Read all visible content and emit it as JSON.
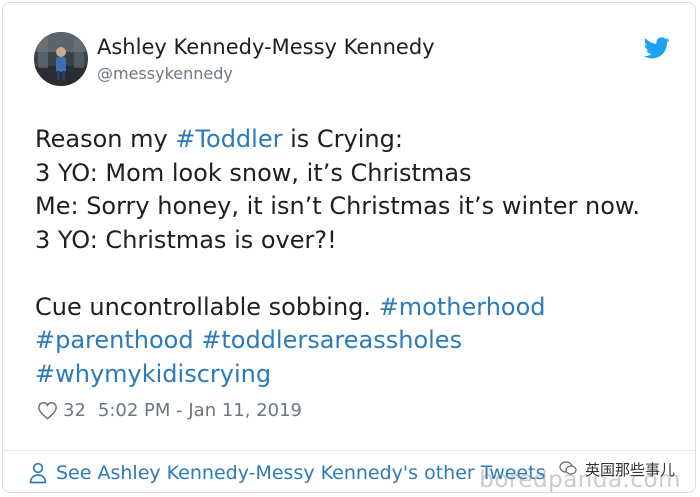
{
  "author": {
    "name": "Ashley Kennedy-Messy Kennedy",
    "handle": "@messykennedy"
  },
  "tweet": {
    "lines": [
      [
        {
          "t": "Reason my "
        },
        {
          "t": "#Toddler",
          "h": true
        },
        {
          "t": " is Crying:"
        }
      ],
      [
        {
          "t": "3 YO: Mom look snow, it’s Christmas"
        }
      ],
      [
        {
          "t": "Me: Sorry honey, it isn’t Christmas it’s winter now."
        }
      ],
      [
        {
          "t": "3 YO: Christmas is over?!"
        }
      ],
      [],
      [
        {
          "t": "Cue uncontrollable sobbing. "
        },
        {
          "t": "#motherhood",
          "h": true
        }
      ],
      [
        {
          "t": "#parenthood",
          "h": true
        },
        {
          "t": " "
        },
        {
          "t": "#toddlersareassholes",
          "h": true
        }
      ],
      [
        {
          "t": "#whymykidiscrying",
          "h": true
        }
      ]
    ]
  },
  "meta": {
    "likes": "32",
    "timestamp": "5:02 PM - Jan 11, 2019"
  },
  "footer": {
    "link_text": "See Ashley Kennedy-Messy Kennedy's other Tweets"
  },
  "watermark": {
    "cn_text": "英国那些事儿",
    "en_text": "boredpanda.com"
  },
  "colors": {
    "hashtag": "#2b7bb9",
    "text": "#1c2022",
    "muted": "#697882",
    "twitter_blue": "#1da1f2"
  },
  "icons": {
    "bird": "twitter-bird-icon",
    "heart": "heart-icon",
    "person": "person-icon"
  }
}
